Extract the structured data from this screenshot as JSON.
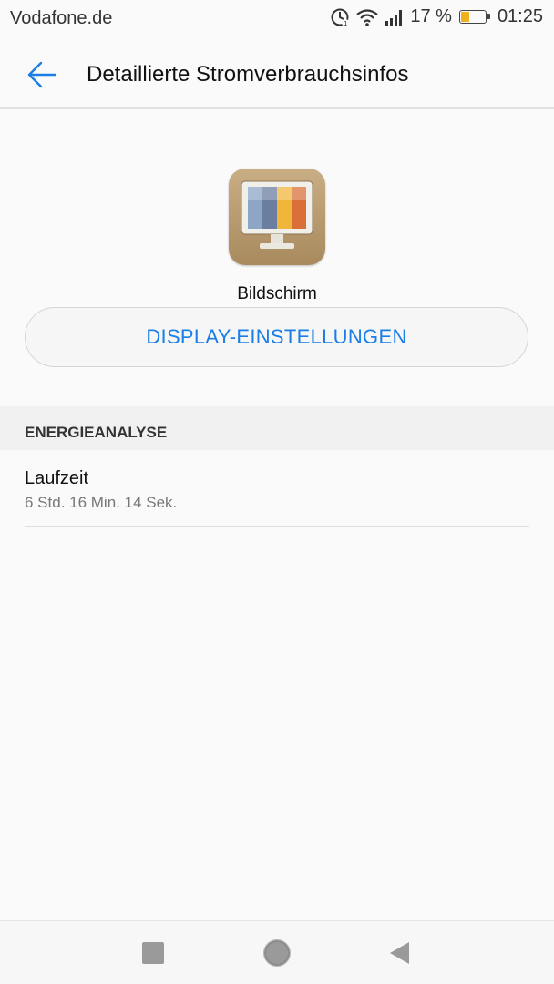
{
  "status_bar": {
    "carrier": "Vodafone.de",
    "battery_percent": "17 %",
    "battery_level": 0.17,
    "time": "01:25",
    "icons": [
      "volte-icon",
      "wifi-icon",
      "signal-icon",
      "battery-icon"
    ]
  },
  "app_bar": {
    "back_icon": "arrow-left-icon",
    "title": "Detaillierte Stromverbrauchsinfos"
  },
  "component": {
    "icon": "monitor-icon",
    "label": "Bildschirm",
    "button_label": "DISPLAY-EINSTELLUNGEN"
  },
  "energy_section": {
    "header": "ENERGIEANALYSE",
    "items": [
      {
        "title": "Laufzeit",
        "value": "6 Std. 16 Min. 14 Sek."
      }
    ]
  },
  "nav_bar": {
    "icons": [
      "recents-square-icon",
      "home-circle-icon",
      "back-triangle-icon"
    ]
  },
  "colors": {
    "accent": "#1a7ee6",
    "background": "#fafafa",
    "battery_fill": "#f2b01e"
  }
}
